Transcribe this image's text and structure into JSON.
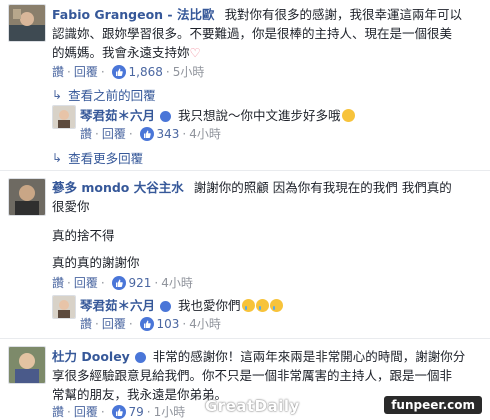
{
  "comment1": {
    "author": "Fabio Grangeon - 法比歐",
    "text_lines": [
      "我對你有很多的感謝，我很幸運這兩年可以",
      "認識妳、跟妳學習很多。不要難過，你是很棒的主持人、現在是一個很美",
      "的媽媽。我會永遠支持妳"
    ],
    "heart": "♡",
    "like": "讚",
    "reply": "回覆",
    "likes": "1,868",
    "time": "5小時"
  },
  "view_previous": "查看之前的回覆",
  "reply1": {
    "author": "琴君茹＊六月",
    "text": "我只想說～你中文進步好多哦",
    "like": "讚",
    "reply": "回覆",
    "likes": "343",
    "time": "4小時"
  },
  "view_more": "查看更多回覆",
  "comment2": {
    "author": "蔘多 mondo 大谷主水",
    "text_lines": [
      "謝謝你的照顧 因為你有我現在的我們 我們真的",
      "很愛你"
    ],
    "extra_lines": [
      "真的捨不得",
      "真的真的謝謝你"
    ],
    "like": "讚",
    "reply": "回覆",
    "likes": "921",
    "time": "4小時"
  },
  "reply2": {
    "author": "琴君茹＊六月",
    "text": "我也愛你們",
    "like": "讚",
    "reply": "回覆",
    "likes": "103",
    "time": "4小時"
  },
  "comment3": {
    "author": "杜力 Dooley",
    "text_lines": [
      "非常的感謝你！這兩年來兩是非常開心的時間，謝謝你分",
      "享很多經驗跟意見給我們。你不只是一個非常厲害的主持人，跟是一個非",
      "常幫的朋友，我永遠是你弟弟。"
    ],
    "like": "讚",
    "reply": "回覆",
    "likes": "79",
    "time": "1小時"
  },
  "watermark": "GreatDaily",
  "badge": "funpeer.com",
  "colors": {
    "link": "#365899",
    "like_blue": "#4a76d8",
    "muted": "#90949c"
  }
}
